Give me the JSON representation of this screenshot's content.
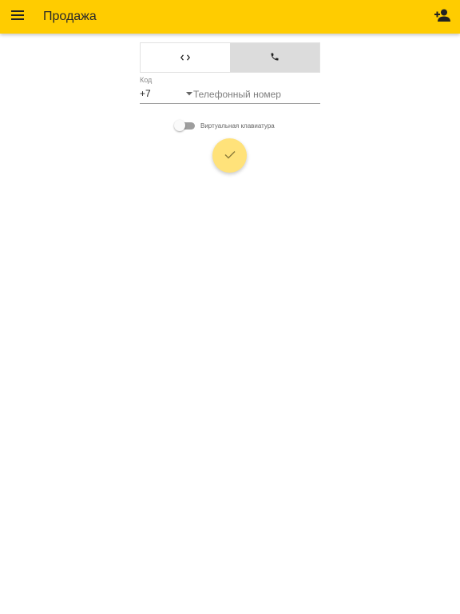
{
  "app_bar": {
    "title": "Продажа",
    "background_color": "#ffcc00",
    "menu_icon": "menu-icon",
    "account_icon": "person-add-icon"
  },
  "input_mode": {
    "options": [
      {
        "icon": "code-brackets-icon",
        "selected": false
      },
      {
        "icon": "phone-icon",
        "selected": true
      }
    ]
  },
  "phone_field": {
    "code_label": "Код",
    "code_value": "+7",
    "placeholder": "Телефонный номер",
    "value": ""
  },
  "virtual_keyboard": {
    "label": "Виртуальная клавиатура",
    "enabled": false
  },
  "confirm_button": {
    "icon": "check-icon",
    "color": "#ffe27a"
  }
}
